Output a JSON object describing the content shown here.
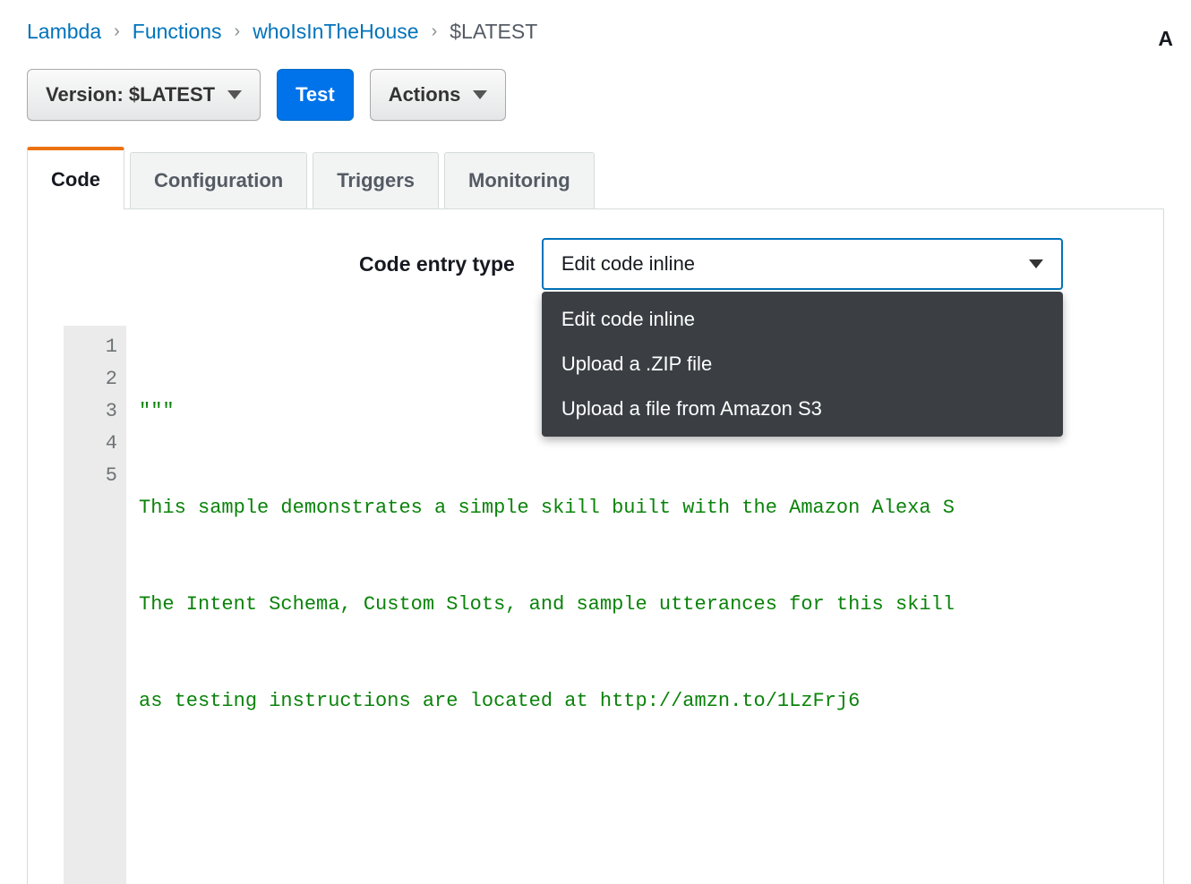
{
  "breadcrumb": {
    "items": [
      {
        "label": "Lambda",
        "link": true
      },
      {
        "label": "Functions",
        "link": true
      },
      {
        "label": "whoIsInTheHouse",
        "link": true
      },
      {
        "label": "$LATEST",
        "link": false
      }
    ]
  },
  "topRight": "A",
  "toolbar": {
    "version_label": "Version: $LATEST",
    "test_label": "Test",
    "actions_label": "Actions"
  },
  "tabs": [
    {
      "label": "Code",
      "active": true
    },
    {
      "label": "Configuration",
      "active": false
    },
    {
      "label": "Triggers",
      "active": false
    },
    {
      "label": "Monitoring",
      "active": false
    }
  ],
  "codeEntry": {
    "label": "Code entry type",
    "selected": "Edit code inline",
    "options": [
      "Edit code inline",
      "Upload a .ZIP file",
      "Upload a file from Amazon S3"
    ]
  },
  "editor": {
    "lines": [
      "\"\"\"",
      "This sample demonstrates a simple skill built with the Amazon Alexa S",
      "The Intent Schema, Custom Slots, and sample utterances for this skill",
      "as testing instructions are located at http://amzn.to/1LzFrj6",
      ""
    ]
  }
}
